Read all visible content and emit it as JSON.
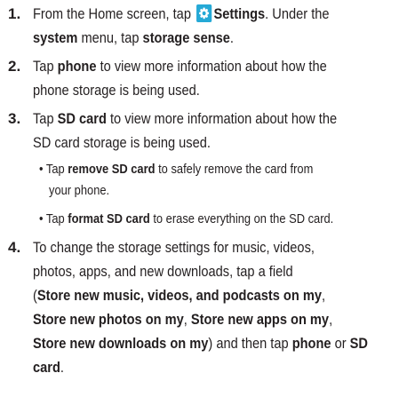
{
  "steps": [
    {
      "number": "1.",
      "lines": [
        {
          "a": "From the Home screen, tap ",
          "b": "Settings",
          "c": ". Under the"
        },
        {
          "b1": "system",
          "a": " menu, tap ",
          "b2": "storage sense",
          "c": "."
        }
      ]
    },
    {
      "number": "2.",
      "lines": [
        {
          "a": "Tap ",
          "b": "phone",
          "c": " to view more information about how the"
        },
        {
          "a": "phone storage is being used."
        }
      ]
    },
    {
      "number": "3.",
      "lines": [
        {
          "a": "Tap ",
          "b": "SD card",
          "c": " to view more information about how the"
        },
        {
          "a": "SD card storage is being used."
        }
      ],
      "bullets": [
        {
          "bullet": "•",
          "a": "Tap ",
          "b": "remove SD card",
          "c": " to safely remove the card from",
          "cont": "your phone."
        },
        {
          "bullet": "•",
          "a": "Tap ",
          "b": "format SD card",
          "c": " to erase everything on the SD card."
        }
      ]
    },
    {
      "number": "4.",
      "lines": [
        {
          "a": "To change the storage settings for music, videos,"
        },
        {
          "a": "photos, apps, and new downloads, tap a field"
        },
        {
          "a": "(",
          "b": "Store new music, videos, and podcasts on my",
          "c": ","
        },
        {
          "b": "Store new photos on my",
          "a": ", ",
          "b2": "Store new apps on my",
          "c": ","
        },
        {
          "b": "Store new downloads on my",
          "a": ") and then tap ",
          "b2": "phone",
          "c": " or ",
          "b3": "SD"
        },
        {
          "b": "card",
          "c": "."
        }
      ]
    }
  ],
  "icons": {
    "settings": "gear-icon"
  },
  "colors": {
    "text": "#231f20",
    "icon_bg": "#25a9d6"
  }
}
